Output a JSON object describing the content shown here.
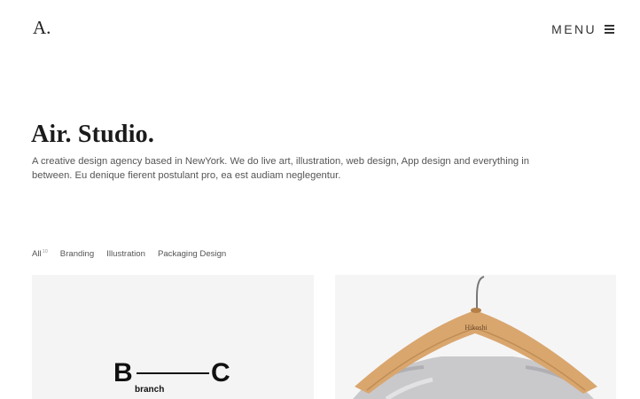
{
  "header": {
    "logo": "A.",
    "menu_label": "MENU"
  },
  "hero": {
    "title": "Air. Studio.",
    "description_line1": "A creative design agency based in NewYork. We do live art, illustration, web design, App design and everything in",
    "description_line2": "between. Eu denique fierent postulant pro, ea est audiam neglegentur."
  },
  "filters": [
    {
      "label": "All",
      "count": "10"
    },
    {
      "label": "Branding"
    },
    {
      "label": "Illustration"
    },
    {
      "label": "Packaging Design"
    }
  ],
  "portfolio": {
    "card1": {
      "letter_left": "B",
      "letter_right": "C",
      "subtext": "branch"
    },
    "card2": {
      "hanger_brand": "Hikoshi"
    }
  },
  "colors": {
    "text_dark": "#1b1b1b",
    "text_muted": "#555555",
    "card_bg": "#f4f4f4",
    "hanger_wood": "#d9a66e"
  }
}
